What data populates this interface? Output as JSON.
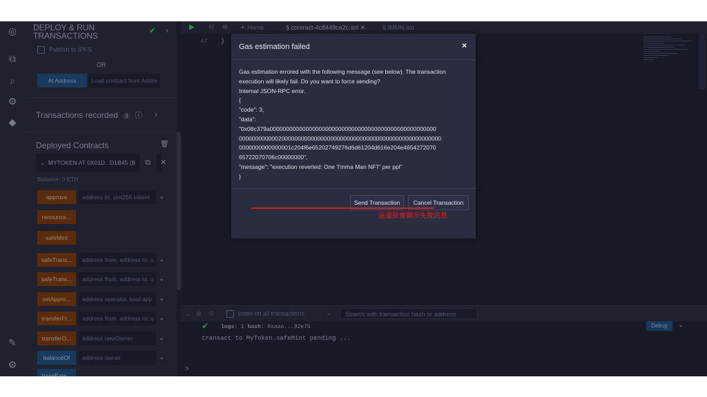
{
  "side_panel": {
    "title_line1": "DEPLOY & RUN",
    "title_line2": "TRANSACTIONS",
    "publish_ipfs": "Publish to IPFS",
    "or_label": "OR",
    "at_address_button": "At Address",
    "load_contract_placeholder": "Load contract from Addre",
    "transactions_recorded": "Transactions recorded",
    "transactions_count": "3",
    "deployed_contracts": "Deployed Contracts",
    "contract_name": "MYTOKEN AT 0X01D...D1B45 (B",
    "balance": "Balance: 0 ETH",
    "functions": [
      {
        "label": "approve",
        "args": "address to, uint256 tokenI"
      },
      {
        "label": "renounce...",
        "args": ""
      },
      {
        "label": "safeMint",
        "args": ""
      },
      {
        "label": "safeTrans...",
        "args": "address from, address to, u"
      },
      {
        "label": "safeTrans...",
        "args": "address from, address to, u"
      },
      {
        "label": "setAppro...",
        "args": "address operator, bool app"
      },
      {
        "label": "transferFr...",
        "args": "address from, address to, u"
      },
      {
        "label": "transferO...",
        "args": "address newOwner"
      },
      {
        "label": "balanceOf",
        "args": "address owner"
      },
      {
        "label": "baseExte...",
        "args": ""
      }
    ]
  },
  "tabs": {
    "home": "Home",
    "contract": "contract-4c8448ca2c.sol",
    "immn": "IMMN.sol"
  },
  "editor": {
    "line_number": "47",
    "code": "}"
  },
  "terminal": {
    "count": "0",
    "listen_label": "listen on all transactions",
    "search_placeholder": "Search with transaction hash or address",
    "logs_label": "logs:",
    "logs_value": "1",
    "hash_label": "hash:",
    "hash_value": "0xaaa...92e7b",
    "pending": "transact to MyToken.safeMint pending ...",
    "debug_button": "Debug",
    "prompt": ">"
  },
  "modal": {
    "title": "Gas estimation failed",
    "close": "×",
    "lines": [
      "Gas estimation errored with the following message (see below). The transaction",
      "execution will likely fail. Do you want to force sending?",
      "Internal JSON-RPC error.",
      "{",
      "\"code\": 3,",
      "\"data\":",
      "\"0x08c379a000000000000000000000000000000000000000000000000000",
      "00000000000020000000000000000000000000000000000000000000000000",
      "0000000000000001c204f6e65202749276d6d61204d616e204e4654272070",
      "65722070706c00000000\",",
      "\"message\": \"execution reverted: One 'I'mma Man NFT' per ppl\"",
      "}"
    ],
    "annotation": "這邊就會顯示失敗訊息",
    "send_button": "Send Transaction",
    "cancel_button": "Cancel Transaction"
  }
}
